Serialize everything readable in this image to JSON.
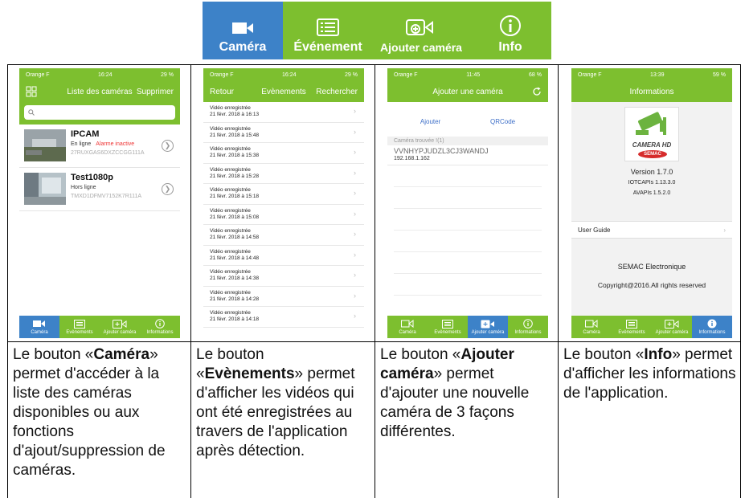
{
  "top_tabs": [
    {
      "label": "Caméra",
      "icon": "camera-icon",
      "active": true
    },
    {
      "label": "Événement",
      "icon": "list-icon",
      "active": false
    },
    {
      "label": "Ajouter caméra",
      "icon": "add-camera-icon",
      "active": false
    },
    {
      "label": "Info",
      "icon": "info-icon",
      "active": false
    }
  ],
  "colors": {
    "green": "#7dbf2f",
    "blue": "#3d82c8",
    "alarm": "#e33333"
  },
  "screen1": {
    "status": {
      "carrier": "Orange F",
      "time": "16:24",
      "battery": "29 %"
    },
    "title": "Liste des caméras",
    "right_action": "Supprimer",
    "cameras": [
      {
        "name": "IPCAM",
        "status": "En ligne",
        "alarm": "Alarme inactive",
        "uid": "27RUXGAS6DXZCCGG111A"
      },
      {
        "name": "Test1080p",
        "status": "Hors ligne",
        "alarm": "",
        "uid": "TMXD1DFMV7152K7R111A"
      }
    ]
  },
  "screen2": {
    "status": {
      "carrier": "Orange F",
      "time": "16:24",
      "battery": "29 %"
    },
    "left_action": "Retour",
    "title": "Evènements",
    "right_action": "Rechercher",
    "events": [
      {
        "title": "Vidéo enregistrée",
        "date": "21 févr. 2018 à 16:13"
      },
      {
        "title": "Vidéo enregistrée",
        "date": "21 févr. 2018 à 15:48"
      },
      {
        "title": "Vidéo enregistrée",
        "date": "21 févr. 2018 à 15:38"
      },
      {
        "title": "Vidéo enregistrée",
        "date": "21 févr. 2018 à 15:28"
      },
      {
        "title": "Vidéo enregistrée",
        "date": "21 févr. 2018 à 15:18"
      },
      {
        "title": "Vidéo enregistrée",
        "date": "21 févr. 2018 à 15:08"
      },
      {
        "title": "Vidéo enregistrée",
        "date": "21 févr. 2018 à 14:58"
      },
      {
        "title": "Vidéo enregistrée",
        "date": "21 févr. 2018 à 14:48"
      },
      {
        "title": "Vidéo enregistrée",
        "date": "21 févr. 2018 à 14:38"
      },
      {
        "title": "Vidéo enregistrée",
        "date": "21 févr. 2018 à 14:28"
      },
      {
        "title": "Vidéo enregistrée",
        "date": "21 févr. 2018 à 14:18"
      }
    ]
  },
  "screen3": {
    "status": {
      "carrier": "Orange F",
      "time": "11:45",
      "battery": "68 %"
    },
    "title": "Ajouter une caméra",
    "link_add": "Ajouter",
    "link_qr": "QRCode",
    "found_header": "Caméra trouvée !(1)",
    "found_uid": "VVNHYPJUDZL3CJ3WANDJ",
    "found_ip": "192.168.1.162"
  },
  "screen4": {
    "status": {
      "carrier": "Orange F",
      "time": "13:39",
      "battery": "59 %"
    },
    "title": "Informations",
    "logo_text": "CAMERA HD",
    "logo_brand": "SEMAC",
    "version": "Version 1.7.0",
    "iotc": "IOTCAPIs 1.13.3.0",
    "av": "AVAPIs 1.5.2.0",
    "guide": "User Guide",
    "company": "SEMAC Electronique",
    "copyright": "Copyright@2016.All rights reserved"
  },
  "bottom_tabs": [
    "Caméra",
    "Evènements",
    "Ajouter caméra",
    "Informations"
  ],
  "descriptions": [
    {
      "pre": "Le bouton «",
      "bold": "Caméra",
      "post": "» permet d'accéder à la liste des caméras disponibles ou aux fonctions d'ajout/suppression de caméras."
    },
    {
      "pre": "Le bouton «",
      "bold": "Evènements",
      "post": "» permet d'afficher les vidéos qui ont été enregistrées au travers de l'application après détection."
    },
    {
      "pre": "Le bouton «",
      "bold": "Ajouter caméra",
      "post": "» permet d'ajouter une nouvelle caméra de 3 façons différentes."
    },
    {
      "pre": "Le bouton «",
      "bold": "Info",
      "post": "» permet d'afficher les informations de l'application."
    }
  ]
}
